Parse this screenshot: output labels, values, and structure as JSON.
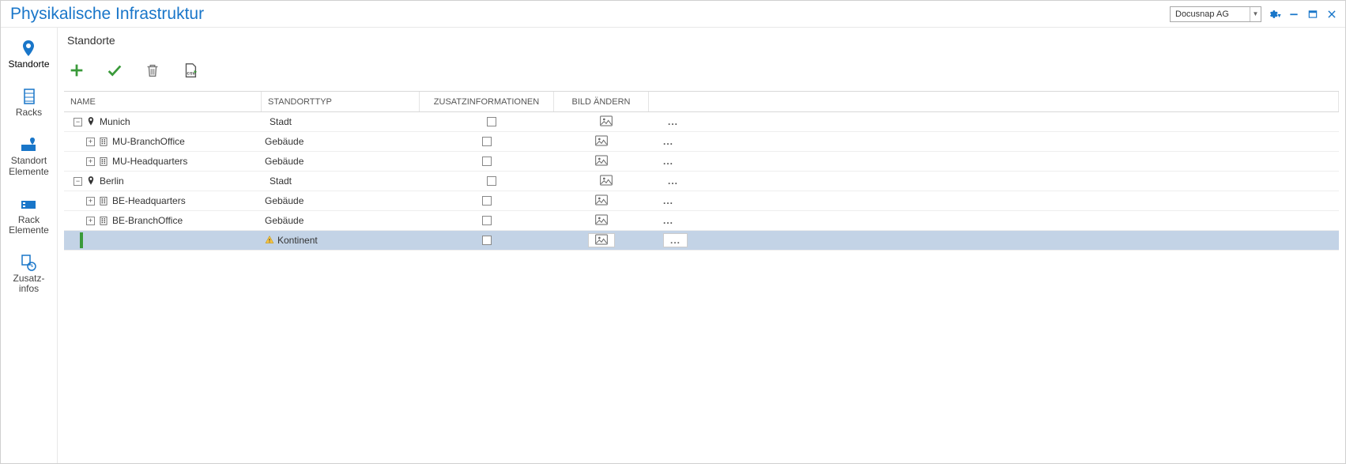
{
  "titlebar": {
    "title": "Physikalische Infrastruktur",
    "org": "Docusnap AG"
  },
  "sidenav": {
    "items": [
      {
        "label": "Standorte"
      },
      {
        "label": "Racks"
      },
      {
        "label_line1": "Standort",
        "label_line2": "Elemente"
      },
      {
        "label_line1": "Rack",
        "label_line2": "Elemente"
      },
      {
        "label_line1": "Zusatz-",
        "label_line2": "infos"
      }
    ]
  },
  "breadcrumb": "Standorte",
  "grid": {
    "columns": {
      "name": "Name",
      "type": "Standorttyp",
      "extra": "Zusatzinformationen",
      "img": "Bild ändern"
    },
    "rows": [
      {
        "level": 0,
        "expanded": true,
        "icon": "pin",
        "name": "Munich",
        "type": "Stadt"
      },
      {
        "level": 1,
        "expanded": false,
        "icon": "building",
        "name": "MU-BranchOffice",
        "type": "Gebäude"
      },
      {
        "level": 1,
        "expanded": false,
        "icon": "building",
        "name": "MU-Headquarters",
        "type": "Gebäude"
      },
      {
        "level": 0,
        "expanded": true,
        "icon": "pin",
        "name": "Berlin",
        "type": "Stadt"
      },
      {
        "level": 1,
        "expanded": false,
        "icon": "building",
        "name": "BE-Headquarters",
        "type": "Gebäude"
      },
      {
        "level": 1,
        "expanded": false,
        "icon": "building",
        "name": "BE-BranchOffice",
        "type": "Gebäude"
      }
    ],
    "new_row": {
      "type": "Kontinent"
    },
    "ellipsis": "..."
  }
}
